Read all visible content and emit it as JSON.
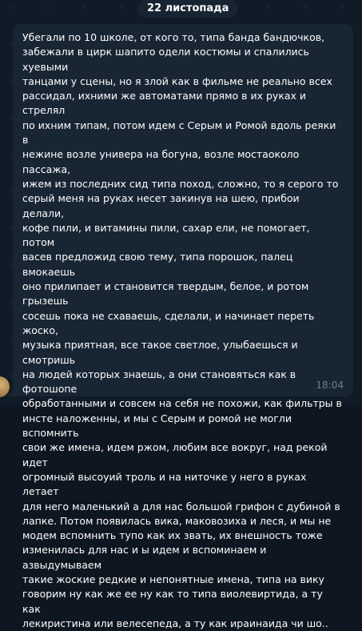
{
  "chat": {
    "date_label": "22 листопада",
    "message": {
      "text": "Убегали по 10 школе, от кого то, типа банда бандючков,\nзабежали в цирк шапито одели костюмы и спалились хуевыми\nтанцами у сцены, но я злой как в фильме не реально всех\nрассидал,  ихними же автоматами прямо в их руках и стрелял\nпо ихним типам, потом идем с Серым и Ромой вдоль реяки в\nнежине возле универа на богуна, возле мостаоколо пассажа,\nижем из последних сид типа поход, сложно, то я серого то\nсерый меня на руках несет закинув на шею, прибои делали,\nкофе пили, и витамины пили, сахар ели, не помогает, потом\nвасев предложид свою тему, типа порошок, палец вмокаешь\nоно прилипает и становится твердым, белое, и ротом грызешь\nсосешь пока не схаваешь, сделали, и начинает переть жоско,\nмузыка приятная, все такое светлое, улыбаешься и смотришь\nна людей которых знаешь, а они становяться как в фотошопе\nобработанными и совсем на себя не похожи, как фильтры в\nинсте наложенны, и мы с Серым и ромой не могли вспомнить\nсвои же имена, идем ржом, любим все вокруг, над рекой идет\nогромный высоуий троль и на ниточке у него в руках летает\nдля него маленький а для нас большой грифон с дубиной в\nлапке. Потом появилась вика, маковозиха и леся, и мы не\nмодем вспомнить тупо как их звать, их внешность тоже\nизменилась для нас и ы идем и вспоминаем и азвыдумываем\nтакие жоские редкие и непонятные имена, типа на вику\nговорим ну как же ее ну как то типа виолевиртида, а ту как\nлекиристина или велесепеда, а ту как ираинаида чи шо..",
      "time": "18:04"
    }
  },
  "colors": {
    "background": "#0e1621",
    "bubble": "#182533",
    "text": "#ffffff",
    "time": "#6d7f8f"
  }
}
